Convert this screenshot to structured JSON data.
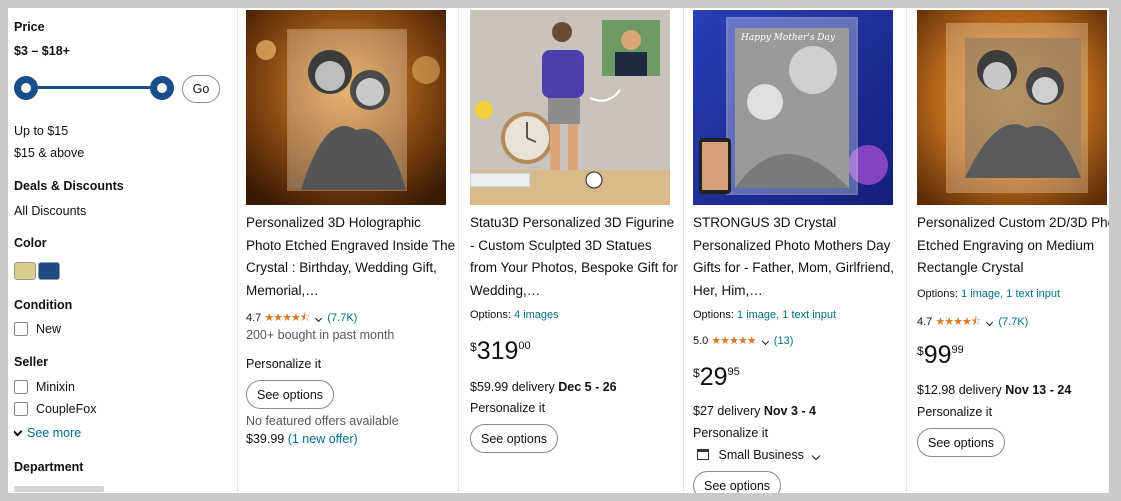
{
  "sidebar": {
    "price": {
      "title": "Price",
      "range": "$3 – $18+",
      "go": "Go",
      "options": [
        "Up to $15",
        "$15 & above"
      ]
    },
    "deals": {
      "title": "Deals & Discounts",
      "item": "All Discounts"
    },
    "color": {
      "title": "Color",
      "swatches": [
        "#d9cd8f",
        "#1f4a86"
      ]
    },
    "condition": {
      "title": "Condition",
      "items": [
        "New"
      ]
    },
    "seller": {
      "title": "Seller",
      "items": [
        "Minixin",
        "CoupleFox"
      ],
      "see_more": "See more"
    },
    "department": {
      "title": "Department"
    }
  },
  "products": [
    {
      "title": "Personalized 3D Holographic Photo Etched Engraved Inside The Crystal : Birthday, Wedding Gift, Memorial,…",
      "rating": "4.7",
      "stars": "★★★★⯪",
      "reviews": "(7.7K)",
      "bought": "200+ bought in past month",
      "personalize": "Personalize it",
      "button": "See options",
      "no_offers": "No featured offers available",
      "offer_price": "$39.99",
      "offer_link": "(1 new offer)"
    },
    {
      "title": "Statu3D Personalized 3D Figurine - Custom Sculpted 3D Statues from Your Photos, Bespoke Gift for Wedding,…",
      "options_label": "Options:",
      "options_value": "4 images",
      "price_symbol": "$",
      "price_whole": "319",
      "price_fraction": "00",
      "delivery_prefix": "$59.99 delivery",
      "delivery_dates": "Dec 5 - 26",
      "personalize": "Personalize it",
      "button": "See options"
    },
    {
      "title": "STRONGUS 3D Crystal Personalized Photo Mothers Day Gifts for - Father, Mom, Girlfriend, Her, Him,…",
      "options_label": "Options:",
      "options_value": "1 image, 1 text input",
      "rating": "5.0",
      "stars": "★★★★★",
      "reviews": "(13)",
      "price_symbol": "$",
      "price_whole": "29",
      "price_fraction": "95",
      "delivery_prefix": "$27 delivery",
      "delivery_dates": "Nov 3 - 4",
      "personalize": "Personalize it",
      "small_business": "Small Business",
      "button": "See options",
      "image_text": "Happy Mother's Day"
    },
    {
      "title": "Personalized Custom 2D/3D Photo Etched Engraving on Medium Rectangle Crystal",
      "options_label": "Options:",
      "options_value": "1 image, 1 text input",
      "rating": "4.7",
      "stars": "★★★★⯪",
      "reviews": "(7.7K)",
      "price_symbol": "$",
      "price_whole": "99",
      "price_fraction": "99",
      "delivery_prefix": "$12.98 delivery",
      "delivery_dates": "Nov 13 - 24",
      "personalize": "Personalize it",
      "button": "See options"
    }
  ]
}
